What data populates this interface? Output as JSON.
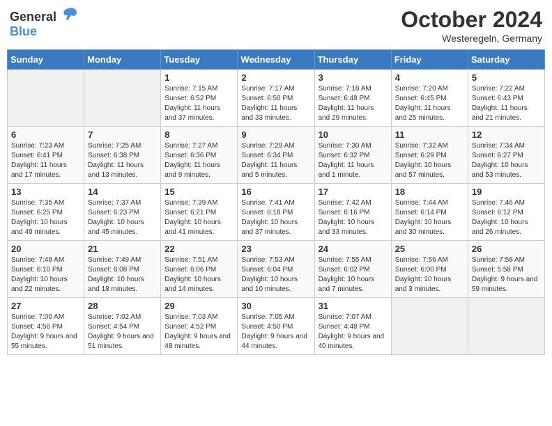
{
  "header": {
    "logo_general": "General",
    "logo_blue": "Blue",
    "month": "October 2024",
    "location": "Westeregeln, Germany"
  },
  "weekdays": [
    "Sunday",
    "Monday",
    "Tuesday",
    "Wednesday",
    "Thursday",
    "Friday",
    "Saturday"
  ],
  "weeks": [
    [
      {
        "day": "",
        "info": ""
      },
      {
        "day": "",
        "info": ""
      },
      {
        "day": "1",
        "info": "Sunrise: 7:15 AM\nSunset: 6:52 PM\nDaylight: 11 hours and 37 minutes."
      },
      {
        "day": "2",
        "info": "Sunrise: 7:17 AM\nSunset: 6:50 PM\nDaylight: 11 hours and 33 minutes."
      },
      {
        "day": "3",
        "info": "Sunrise: 7:18 AM\nSunset: 6:48 PM\nDaylight: 11 hours and 29 minutes."
      },
      {
        "day": "4",
        "info": "Sunrise: 7:20 AM\nSunset: 6:45 PM\nDaylight: 11 hours and 25 minutes."
      },
      {
        "day": "5",
        "info": "Sunrise: 7:22 AM\nSunset: 6:43 PM\nDaylight: 11 hours and 21 minutes."
      }
    ],
    [
      {
        "day": "6",
        "info": "Sunrise: 7:23 AM\nSunset: 6:41 PM\nDaylight: 11 hours and 17 minutes."
      },
      {
        "day": "7",
        "info": "Sunrise: 7:25 AM\nSunset: 6:38 PM\nDaylight: 11 hours and 13 minutes."
      },
      {
        "day": "8",
        "info": "Sunrise: 7:27 AM\nSunset: 6:36 PM\nDaylight: 11 hours and 9 minutes."
      },
      {
        "day": "9",
        "info": "Sunrise: 7:29 AM\nSunset: 6:34 PM\nDaylight: 11 hours and 5 minutes."
      },
      {
        "day": "10",
        "info": "Sunrise: 7:30 AM\nSunset: 6:32 PM\nDaylight: 11 hours and 1 minute."
      },
      {
        "day": "11",
        "info": "Sunrise: 7:32 AM\nSunset: 6:29 PM\nDaylight: 10 hours and 57 minutes."
      },
      {
        "day": "12",
        "info": "Sunrise: 7:34 AM\nSunset: 6:27 PM\nDaylight: 10 hours and 53 minutes."
      }
    ],
    [
      {
        "day": "13",
        "info": "Sunrise: 7:35 AM\nSunset: 6:25 PM\nDaylight: 10 hours and 49 minutes."
      },
      {
        "day": "14",
        "info": "Sunrise: 7:37 AM\nSunset: 6:23 PM\nDaylight: 10 hours and 45 minutes."
      },
      {
        "day": "15",
        "info": "Sunrise: 7:39 AM\nSunset: 6:21 PM\nDaylight: 10 hours and 41 minutes."
      },
      {
        "day": "16",
        "info": "Sunrise: 7:41 AM\nSunset: 6:18 PM\nDaylight: 10 hours and 37 minutes."
      },
      {
        "day": "17",
        "info": "Sunrise: 7:42 AM\nSunset: 6:16 PM\nDaylight: 10 hours and 33 minutes."
      },
      {
        "day": "18",
        "info": "Sunrise: 7:44 AM\nSunset: 6:14 PM\nDaylight: 10 hours and 30 minutes."
      },
      {
        "day": "19",
        "info": "Sunrise: 7:46 AM\nSunset: 6:12 PM\nDaylight: 10 hours and 26 minutes."
      }
    ],
    [
      {
        "day": "20",
        "info": "Sunrise: 7:48 AM\nSunset: 6:10 PM\nDaylight: 10 hours and 22 minutes."
      },
      {
        "day": "21",
        "info": "Sunrise: 7:49 AM\nSunset: 6:08 PM\nDaylight: 10 hours and 18 minutes."
      },
      {
        "day": "22",
        "info": "Sunrise: 7:51 AM\nSunset: 6:06 PM\nDaylight: 10 hours and 14 minutes."
      },
      {
        "day": "23",
        "info": "Sunrise: 7:53 AM\nSunset: 6:04 PM\nDaylight: 10 hours and 10 minutes."
      },
      {
        "day": "24",
        "info": "Sunrise: 7:55 AM\nSunset: 6:02 PM\nDaylight: 10 hours and 7 minutes."
      },
      {
        "day": "25",
        "info": "Sunrise: 7:56 AM\nSunset: 6:00 PM\nDaylight: 10 hours and 3 minutes."
      },
      {
        "day": "26",
        "info": "Sunrise: 7:58 AM\nSunset: 5:58 PM\nDaylight: 9 hours and 59 minutes."
      }
    ],
    [
      {
        "day": "27",
        "info": "Sunrise: 7:00 AM\nSunset: 4:56 PM\nDaylight: 9 hours and 55 minutes."
      },
      {
        "day": "28",
        "info": "Sunrise: 7:02 AM\nSunset: 4:54 PM\nDaylight: 9 hours and 51 minutes."
      },
      {
        "day": "29",
        "info": "Sunrise: 7:03 AM\nSunset: 4:52 PM\nDaylight: 9 hours and 48 minutes."
      },
      {
        "day": "30",
        "info": "Sunrise: 7:05 AM\nSunset: 4:50 PM\nDaylight: 9 hours and 44 minutes."
      },
      {
        "day": "31",
        "info": "Sunrise: 7:07 AM\nSunset: 4:48 PM\nDaylight: 9 hours and 40 minutes."
      },
      {
        "day": "",
        "info": ""
      },
      {
        "day": "",
        "info": ""
      }
    ]
  ]
}
